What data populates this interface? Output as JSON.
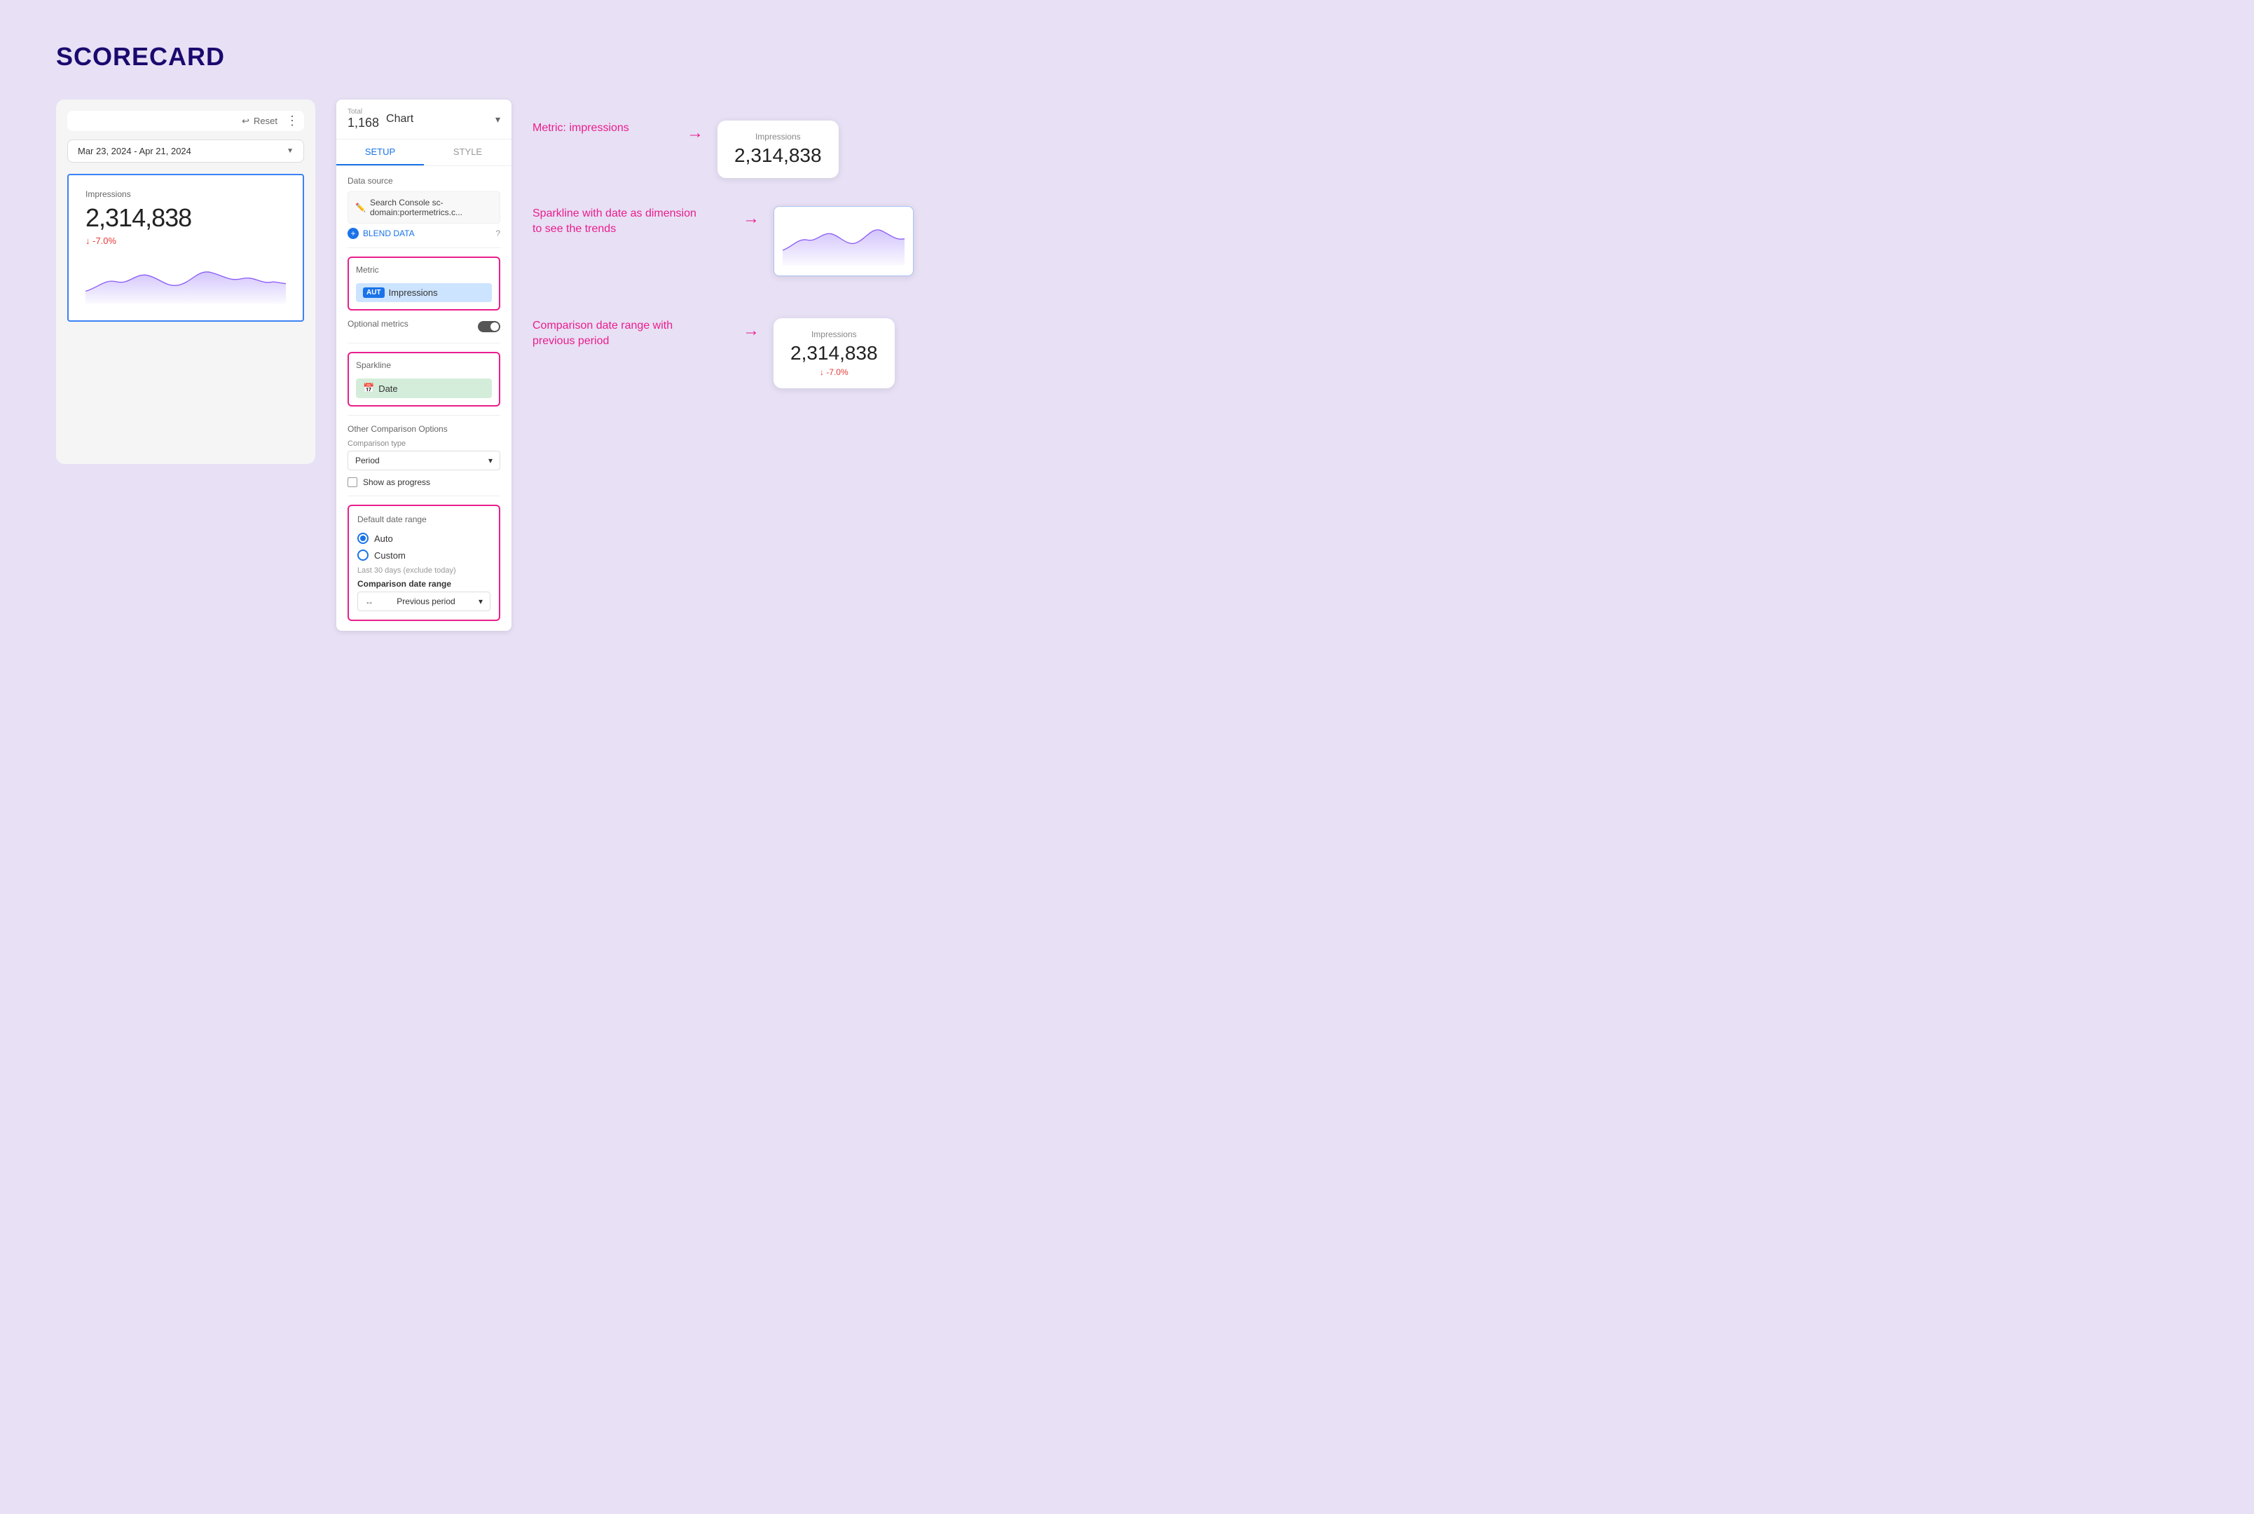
{
  "page": {
    "title": "SCORECARD"
  },
  "toolbar": {
    "reset_label": "Reset",
    "more_icon": "⋮"
  },
  "date_range": {
    "value": "Mar 23, 2024 - Apr 21, 2024"
  },
  "scorecard": {
    "label": "Impressions",
    "value": "2,314,838",
    "change": "↓ -7.0%"
  },
  "chart_panel": {
    "total_label": "Total",
    "total_value": "1,168",
    "chart_title": "Chart",
    "tabs": [
      "SETUP",
      "STYLE"
    ],
    "active_tab": "SETUP"
  },
  "data_source": {
    "label": "Data source",
    "source_text": "Search Console sc-domain:portermetrics.c...",
    "blend_label": "BLEND DATA"
  },
  "metric_section": {
    "label": "Metric",
    "aut_badge": "AUT",
    "metric_name": "Impressions"
  },
  "optional_metrics": {
    "label": "Optional metrics"
  },
  "sparkline_section": {
    "label": "Sparkline",
    "date_label": "Date"
  },
  "comparison_section": {
    "label": "Other Comparison Options",
    "type_label": "Comparison type",
    "type_value": "Period",
    "show_progress_label": "Show as progress"
  },
  "date_range_section": {
    "label": "Default date range",
    "auto_label": "Auto",
    "custom_label": "Custom",
    "range_hint": "Last 30 days (exclude today)",
    "comparison_range_label": "Comparison date range",
    "previous_period_label": "Previous period"
  },
  "annotations": {
    "metric_annotation": "Metric: impressions",
    "sparkline_annotation": "Sparkline with date as dimension\nto see the trends",
    "comparison_annotation": "Comparison date range with\nprevious period"
  },
  "annotation_widgets": {
    "metric": {
      "label": "Impressions",
      "value": "2,314,838"
    },
    "comparison": {
      "label": "Impressions",
      "value": "2,314,838",
      "change": "↓ -7.0%"
    }
  }
}
